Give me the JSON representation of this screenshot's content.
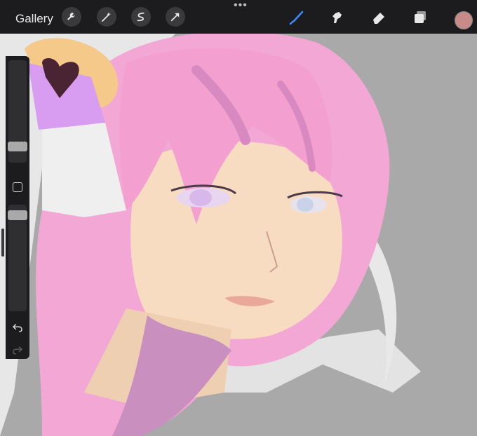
{
  "app": {
    "gallery_label": "Gallery",
    "more_dots": "•••"
  },
  "toolbar": {
    "left_tools": [
      "wrench-icon",
      "magic-wand-icon",
      "selection-icon",
      "transform-arrow-icon"
    ],
    "right_tools": [
      "brush-icon",
      "smudge-icon",
      "eraser-icon",
      "layers-icon"
    ],
    "active_tool": "brush-icon",
    "active_tool_color": "#3b8bff",
    "current_color": "#c98a8a"
  },
  "sidebar": {
    "brush_size_level": 0.88,
    "opacity_level": 0.06
  },
  "artwork": {
    "colors": {
      "background": "#a9a9a9",
      "hair": "#f2a7d4",
      "hair_shadow": "#c98fbf",
      "skin": "#f7dcc2",
      "white_parts": "#e6e6e6",
      "bow_purple": "#d89cf0",
      "bow_dark": "#4a2432",
      "bow_orange": "#f4c98a"
    }
  }
}
